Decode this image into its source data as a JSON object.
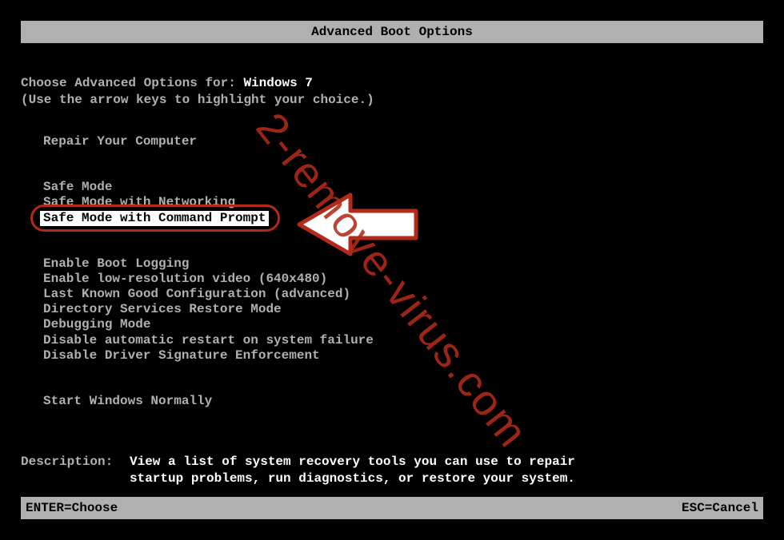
{
  "title": "Advanced Boot Options",
  "choose": {
    "prefix": "Choose Advanced Options for: ",
    "os": "Windows 7"
  },
  "hint": "(Use the arrow keys to highlight your choice.)",
  "menu": {
    "group1": [
      "Repair Your Computer"
    ],
    "group2": [
      "Safe Mode",
      "Safe Mode with Networking",
      "Safe Mode with Command Prompt"
    ],
    "group3": [
      "Enable Boot Logging",
      "Enable low-resolution video (640x480)",
      "Last Known Good Configuration (advanced)",
      "Directory Services Restore Mode",
      "Debugging Mode",
      "Disable automatic restart on system failure",
      "Disable Driver Signature Enforcement"
    ],
    "group4": [
      "Start Windows Normally"
    ],
    "selected_index": 2,
    "highlighted_group": "group2"
  },
  "description": {
    "label": "Description:",
    "text_line1": "View a list of system recovery tools you can use to repair",
    "text_line2": "startup problems, run diagnostics, or restore your system."
  },
  "footer": {
    "left": "ENTER=Choose",
    "right": "ESC=Cancel"
  },
  "watermark": "2-remove-virus.com",
  "annotation": {
    "highlight_color": "#b22a1a",
    "arrow_points_to": "Safe Mode with Command Prompt"
  }
}
